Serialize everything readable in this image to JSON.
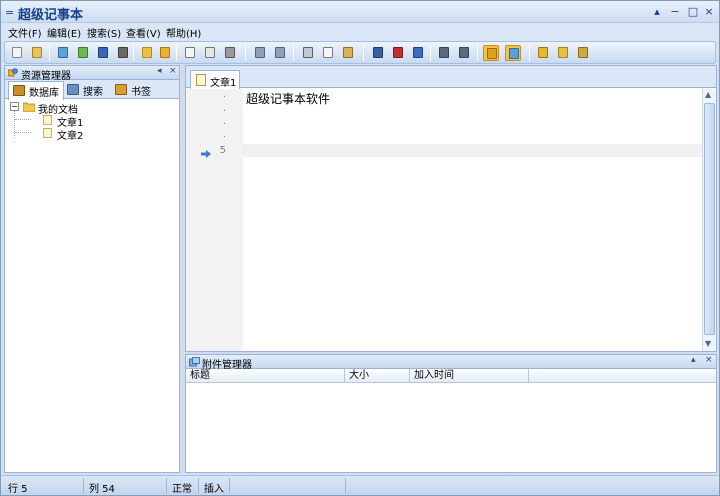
{
  "window": {
    "title": "超级记事本",
    "sys_icon": "=",
    "help_button": "▴",
    "minimize_button": "−",
    "maximize_button": "□",
    "close_button": "×"
  },
  "menu": [
    "文件(F)",
    "编辑(E)",
    "搜索(S)",
    "查看(V)",
    "帮助(H)"
  ],
  "toolbar_icons": [
    {
      "name": "new-icon",
      "color": "#f4f4f4",
      "border": "#888"
    },
    {
      "name": "open-icon",
      "color": "#e9c35c",
      "border": "#a88425"
    },
    {
      "name": "import-icon",
      "color": "#5aa3d8",
      "border": "#2c6aa3"
    },
    {
      "name": "export-icon",
      "color": "#6cb85a",
      "border": "#3c7b2e"
    },
    {
      "name": "save-icon",
      "color": "#3a66b8",
      "border": "#1f3e7a"
    },
    {
      "name": "save-all-icon",
      "color": "#6a6a6a",
      "border": "#3d3d3d"
    },
    {
      "name": "folder-icon",
      "color": "#f0c040",
      "border": "#b08a22"
    },
    {
      "name": "folder-open-icon",
      "color": "#f0b030",
      "border": "#a97a10"
    },
    {
      "name": "print-preview-icon",
      "color": "#f4f4f4",
      "border": "#777"
    },
    {
      "name": "page-setup-icon",
      "color": "#e6e6e6",
      "border": "#777"
    },
    {
      "name": "print-icon",
      "color": "#9a9a9a",
      "border": "#555"
    },
    {
      "name": "undo-icon",
      "color": "#8fa0b8",
      "border": "#52637c"
    },
    {
      "name": "redo-icon",
      "color": "#8fa0b8",
      "border": "#52637c"
    },
    {
      "name": "cut-icon",
      "color": "#c0c8d4",
      "border": "#59606c"
    },
    {
      "name": "copy-icon",
      "color": "#f6f6f6",
      "border": "#7a7a7a"
    },
    {
      "name": "paste-icon",
      "color": "#d8b25a",
      "border": "#8e6f24"
    },
    {
      "name": "find-icon",
      "color": "#3a5ea8",
      "border": "#203a70"
    },
    {
      "name": "find-next-icon",
      "color": "#c03030",
      "border": "#7a1b1b"
    },
    {
      "name": "replace-icon",
      "color": "#3a6ec0",
      "border": "#204480"
    },
    {
      "name": "indent-icon",
      "color": "#5a6a82",
      "border": "#34425a"
    },
    {
      "name": "outdent-icon",
      "color": "#5a6a82",
      "border": "#34425a"
    },
    {
      "name": "explorer-toggle-icon",
      "color": "#e0a020",
      "border": "#a06a00"
    },
    {
      "name": "attachment-toggle-icon",
      "color": "#5aa0d8",
      "border": "#2a6ca0"
    },
    {
      "name": "lock-icon",
      "color": "#e8b830",
      "border": "#9c7410"
    },
    {
      "name": "key-icon",
      "color": "#e8c040",
      "border": "#a08020"
    },
    {
      "name": "options-icon",
      "color": "#d4a840",
      "border": "#8a6a18"
    }
  ],
  "explorer": {
    "title": "资源管理器",
    "pin": "◂",
    "close": "×",
    "tabs": [
      {
        "label": "数据库",
        "icon": "database-icon",
        "color": "#c8902a"
      },
      {
        "label": "搜索",
        "icon": "search-panel-icon",
        "color": "#6a8fc4"
      },
      {
        "label": "书签",
        "icon": "bookmark-icon",
        "color": "#d8a030"
      }
    ],
    "tree": {
      "root_label": "我的文档",
      "root_expander": "−",
      "children": [
        "文章1",
        "文章2"
      ]
    }
  },
  "editor": {
    "tab_label": "文章1",
    "gutter_lines": [
      "·",
      "·",
      "·",
      "·",
      "5"
    ],
    "content_line1": "超级记事本软件"
  },
  "attachments": {
    "title": "附件管理器",
    "pin": "▴",
    "close": "×",
    "columns": [
      "标题",
      "大小",
      "加入时间",
      ""
    ]
  },
  "status": {
    "line": "行 5",
    "column": "列 54",
    "mode": "正常",
    "insert": "插入"
  }
}
